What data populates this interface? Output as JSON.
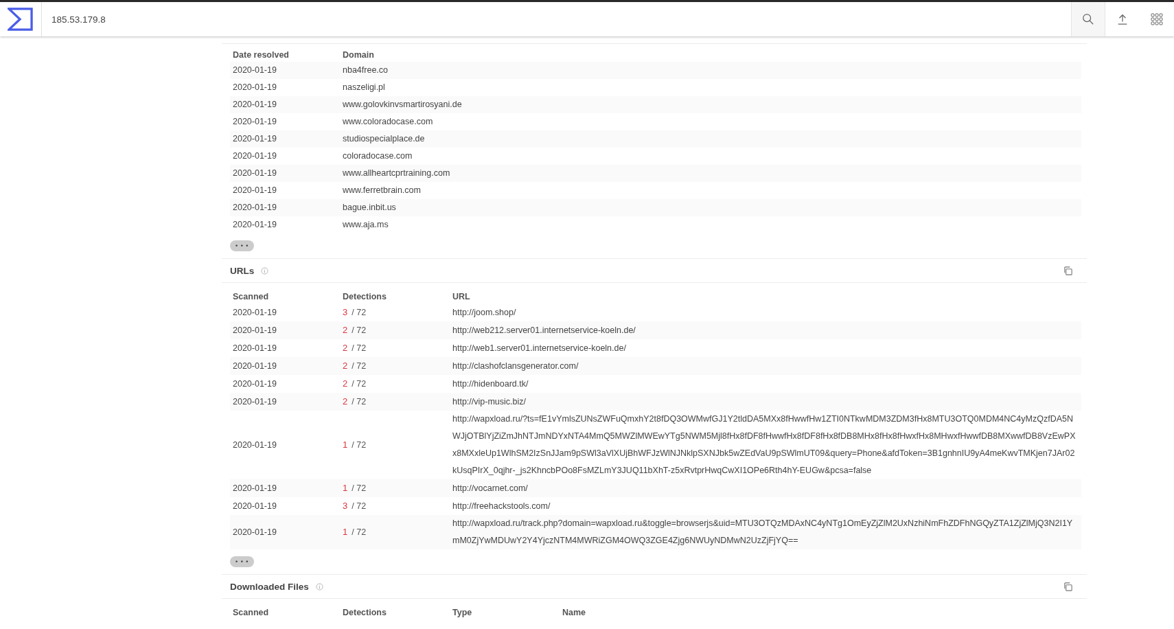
{
  "search": {
    "value": "185.53.179.8"
  },
  "resolutions": {
    "columns": [
      "Date resolved",
      "Domain"
    ],
    "rows": [
      {
        "date": "2020-01-19",
        "domain": "nba4free.co"
      },
      {
        "date": "2020-01-19",
        "domain": "naszeligi.pl"
      },
      {
        "date": "2020-01-19",
        "domain": "www.golovkinvsmartirosyani.de"
      },
      {
        "date": "2020-01-19",
        "domain": "www.coloradocase.com"
      },
      {
        "date": "2020-01-19",
        "domain": "studiospecialplace.de"
      },
      {
        "date": "2020-01-19",
        "domain": "coloradocase.com"
      },
      {
        "date": "2020-01-19",
        "domain": "www.allheartcprtraining.com"
      },
      {
        "date": "2020-01-19",
        "domain": "www.ferretbrain.com"
      },
      {
        "date": "2020-01-19",
        "domain": "bague.inbit.us"
      },
      {
        "date": "2020-01-19",
        "domain": "www.aja.ms"
      }
    ],
    "more": "• • •"
  },
  "urls": {
    "title": "URLs",
    "columns": [
      "Scanned",
      "Detections",
      "URL"
    ],
    "rows": [
      {
        "scanned": "2020-01-19",
        "positives": "3",
        "total": "/ 72",
        "url": "http://joom.shop/"
      },
      {
        "scanned": "2020-01-19",
        "positives": "2",
        "total": "/ 72",
        "url": "http://web212.server01.internetservice-koeln.de/"
      },
      {
        "scanned": "2020-01-19",
        "positives": "2",
        "total": "/ 72",
        "url": "http://web1.server01.internetservice-koeln.de/"
      },
      {
        "scanned": "2020-01-19",
        "positives": "2",
        "total": "/ 72",
        "url": "http://clashofclansgenerator.com/"
      },
      {
        "scanned": "2020-01-19",
        "positives": "2",
        "total": "/ 72",
        "url": "http://hidenboard.tk/"
      },
      {
        "scanned": "2020-01-19",
        "positives": "2",
        "total": "/ 72",
        "url": "http://vip-music.biz/"
      },
      {
        "scanned": "2020-01-19",
        "positives": "1",
        "total": "/ 72",
        "url": "http://wapxload.ru/?ts=fE1vYmlsZUNsZWFuQmxhY2t8fDQ3OWMwfGJ1Y2tldDA5MXx8fHwwfHw1ZTI0NTkwMDM3ZDM3fHx8MTU3OTQ0MDM4NC4yMzQzfDA5NWJjOTBlYjZiZmJhNTJmNDYxNTA4MmQ5MWZlMWEwYTg5NWM5Mjl8fHx8fDF8fHwwfHx8fDF8fHx8fDB8MHx8fHx8fHwxfHx8MHwxfHwwfDB8MXwwfDB8VzEwPXx8MXxleUp1WlhSM2IzSnJJam9pSWl3aVlXUjBhWFJzWlNJNklpSXNJbk5wZEdVaU9pSWlmUT09&query=Phone&afdToken=3B1gnhnIU9yA4meKwvTMKjen7JAr02kUsqPIrX_0qjhr-_js2KhncbPOo8FsMZLmY3JUQ11bXhT-z5xRvtprHwqCwXI1OPe6Rth4hY-EUGw&pcsa=false"
      },
      {
        "scanned": "2020-01-19",
        "positives": "1",
        "total": "/ 72",
        "url": "http://vocarnet.com/"
      },
      {
        "scanned": "2020-01-19",
        "positives": "3",
        "total": "/ 72",
        "url": "http://freehackstools.com/"
      },
      {
        "scanned": "2020-01-19",
        "positives": "1",
        "total": "/ 72",
        "url": "http://wapxload.ru/track.php?domain=wapxload.ru&toggle=browserjs&uid=MTU3OTQzMDAxNC4yNTg1OmEyZjZlM2UxNzhiNmFhZDFhNGQyZTA1ZjZlMjQ3N2I1YmM0ZjYwMDUwY2Y4YjczNTM4MWRiZGM4OWQ3ZGE4Zjg6NWUyNDMwN2UzZjFjYQ=="
      }
    ],
    "more": "• • •"
  },
  "files": {
    "title": "Downloaded Files",
    "columns": [
      "Scanned",
      "Detections",
      "Type",
      "Name"
    ]
  }
}
